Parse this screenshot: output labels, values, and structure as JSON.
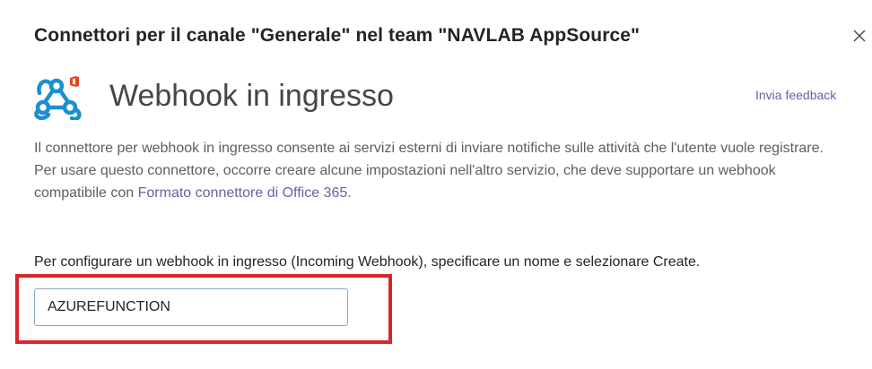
{
  "dialog": {
    "title": "Connettori per il canale \"Generale\" nel team \"NAVLAB AppSource\"",
    "close_icon": "close-icon"
  },
  "connector": {
    "logo_icon": "webhook-icon",
    "name": "Webhook in ingresso",
    "feedback_link": "Invia feedback",
    "description_text": "Il connettore per webhook in ingresso consente ai servizi esterni di inviare notifiche sulle attività che l'utente vuole registrare. Per usare questo connettore, occorre creare alcune impostazioni nell'altro servizio, che deve supportare un webhook compatibile con ",
    "description_link": "Formato connettore di Office 365",
    "description_end": "."
  },
  "setup": {
    "instructions": "Per configurare un webhook in ingresso (Incoming Webhook), specificare un nome e selezionare Create.",
    "name_input_value": "AZUREFUNCTION"
  },
  "colors": {
    "link": "#6264a7",
    "webhook_icon": "#1c8fd0",
    "office_badge": "#e3461c",
    "highlight_border": "#d9262c"
  }
}
